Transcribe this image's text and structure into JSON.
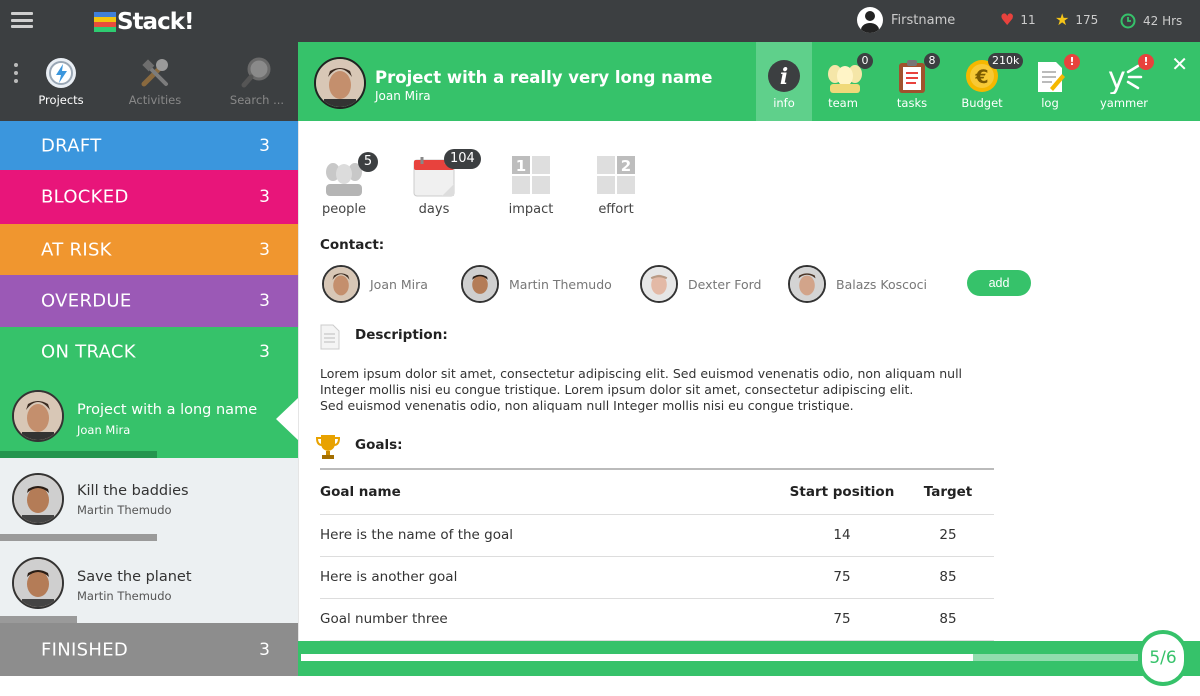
{
  "app": {
    "logo_text": "Stack!",
    "logo_colors": [
      "#3f7fd8",
      "#f1c40f",
      "#e74c3c",
      "#2ecc71"
    ]
  },
  "topbar": {
    "user_name": "Firstname",
    "likes": "11",
    "stars": "175",
    "hours": "42 Hrs",
    "colors": {
      "heart": "#e8423d",
      "star": "#f5c518",
      "clock": "#36c26a"
    }
  },
  "nav": {
    "items": [
      {
        "label": "Projects",
        "icon": "lightning-gear-icon",
        "active": true
      },
      {
        "label": "Activities",
        "icon": "tools-icon",
        "active": false
      },
      {
        "label": "Search ...",
        "icon": "magnifier-icon",
        "active": false
      }
    ]
  },
  "statuses": [
    {
      "name": "DRAFT",
      "count": "3",
      "color": "#3b96dd"
    },
    {
      "name": "BLOCKED",
      "count": "3",
      "color": "#e8157a"
    },
    {
      "name": "AT RISK",
      "count": "3",
      "color": "#f0962f"
    },
    {
      "name": "OVERDUE",
      "count": "3",
      "color": "#9b59b6"
    },
    {
      "name": "ON TRACK",
      "count": "3",
      "color": "#36c26a"
    },
    {
      "name": "FINISHED",
      "count": "3",
      "color": "#8d8d8d"
    }
  ],
  "projects": [
    {
      "title": "Project with a long name",
      "owner": "Joan Mira",
      "progress": 0.53,
      "selected": true
    },
    {
      "title": "Kill the baddies",
      "owner": "Martin Themudo",
      "progress": 0.53,
      "selected": false
    },
    {
      "title": "Save the planet",
      "owner": "Martin Themudo",
      "progress": 0.26,
      "selected": false
    }
  ],
  "header": {
    "title": "Project with a really very long name",
    "owner": "Joan Mira",
    "tabs": [
      {
        "label": "info",
        "icon": "info-icon",
        "badge": ""
      },
      {
        "label": "team",
        "icon": "team-icon",
        "badge": "0"
      },
      {
        "label": "tasks",
        "icon": "clipboard-icon",
        "badge": "8"
      },
      {
        "label": "Budget",
        "icon": "euro-coin-icon",
        "badge": "210k"
      },
      {
        "label": "log",
        "icon": "log-icon",
        "badge": "!"
      },
      {
        "label": "yammer",
        "icon": "yammer-icon",
        "badge": "!"
      }
    ]
  },
  "metrics": [
    {
      "label": "people",
      "badge": "5"
    },
    {
      "label": "days",
      "badge": "104"
    },
    {
      "label": "impact",
      "value": "1"
    },
    {
      "label": "effort",
      "value": "2"
    }
  ],
  "contact": {
    "label": "Contact:",
    "people": [
      "Joan Mira",
      "Martin Themudo",
      "Dexter Ford",
      "Balazs Koscoci"
    ],
    "add_label": "add"
  },
  "description": {
    "label": "Description:",
    "lines": [
      "Lorem ipsum dolor sit amet, consectetur adipiscing elit. Sed euismod venenatis odio, non aliquam null",
      "Integer mollis nisi eu congue tristique.  Lorem ipsum dolor sit amet, consectetur adipiscing elit.",
      "Sed euismod venenatis odio, non aliquam null Integer mollis nisi eu congue tristique."
    ]
  },
  "goals": {
    "label": "Goals:",
    "headers": [
      "Goal name",
      "Start position",
      "Target"
    ],
    "rows": [
      [
        "Here is the name of the goal",
        "14",
        "25"
      ],
      [
        "Here is another goal",
        "75",
        "85"
      ],
      [
        "Goal number three",
        "75",
        "85"
      ]
    ]
  },
  "pager": {
    "label": "5/6",
    "progress": 0.8
  },
  "accent": "#36c26a"
}
